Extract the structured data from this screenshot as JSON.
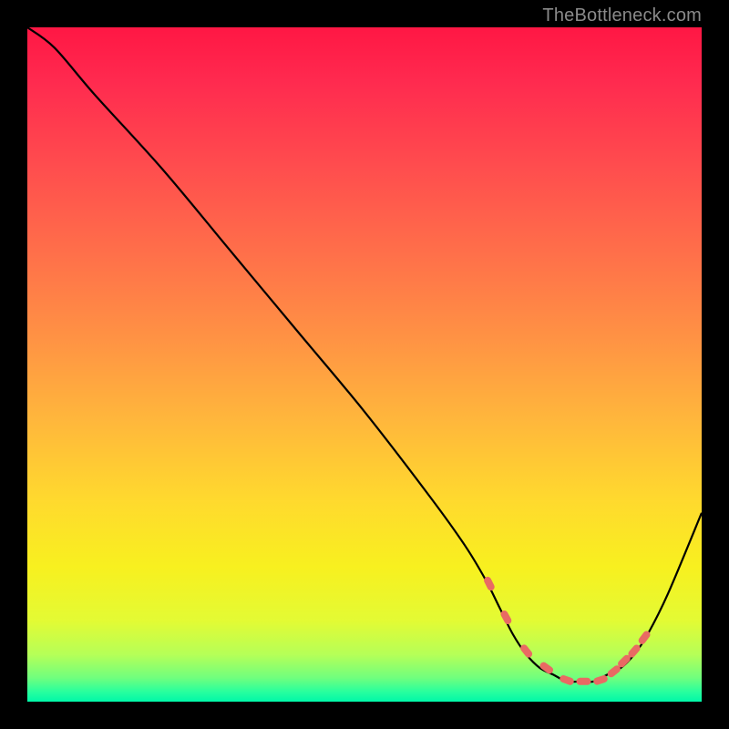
{
  "attribution": "TheBottleneck.com",
  "chart_data": {
    "type": "line",
    "title": "",
    "xlabel": "",
    "ylabel": "",
    "xlim": [
      0,
      100
    ],
    "ylim": [
      0,
      100
    ],
    "series": [
      {
        "name": "bottleneck-curve",
        "x": [
          0,
          4,
          10,
          20,
          30,
          40,
          50,
          60,
          65,
          68,
          70,
          72,
          74,
          76,
          78,
          80,
          82,
          84,
          86,
          88,
          90,
          92,
          95,
          100
        ],
        "values": [
          100,
          97,
          90,
          79,
          67,
          55,
          43,
          30,
          23,
          18,
          14,
          10,
          7,
          5,
          4,
          3,
          3,
          3,
          4,
          5,
          7,
          10,
          16,
          28
        ]
      }
    ],
    "markers": {
      "name": "optimal-range",
      "color": "#e96a63",
      "x": [
        68.5,
        71,
        74,
        77,
        80,
        82.5,
        85,
        87,
        88.5,
        90,
        91.5
      ],
      "values": [
        17.5,
        12.5,
        7.5,
        5,
        3.2,
        3,
        3.2,
        4.5,
        6,
        7.5,
        9.5
      ]
    },
    "gradient_stops": [
      {
        "offset": 0.0,
        "color": "#ff1744"
      },
      {
        "offset": 0.08,
        "color": "#ff2a4f"
      },
      {
        "offset": 0.2,
        "color": "#ff4b4e"
      },
      {
        "offset": 0.33,
        "color": "#ff6e4a"
      },
      {
        "offset": 0.46,
        "color": "#ff9244"
      },
      {
        "offset": 0.58,
        "color": "#ffb63c"
      },
      {
        "offset": 0.7,
        "color": "#ffd92e"
      },
      {
        "offset": 0.8,
        "color": "#f8f01f"
      },
      {
        "offset": 0.88,
        "color": "#e3fb34"
      },
      {
        "offset": 0.93,
        "color": "#b6ff57"
      },
      {
        "offset": 0.965,
        "color": "#6fff7e"
      },
      {
        "offset": 0.985,
        "color": "#29ff9d"
      },
      {
        "offset": 1.0,
        "color": "#00f7a8"
      }
    ]
  }
}
